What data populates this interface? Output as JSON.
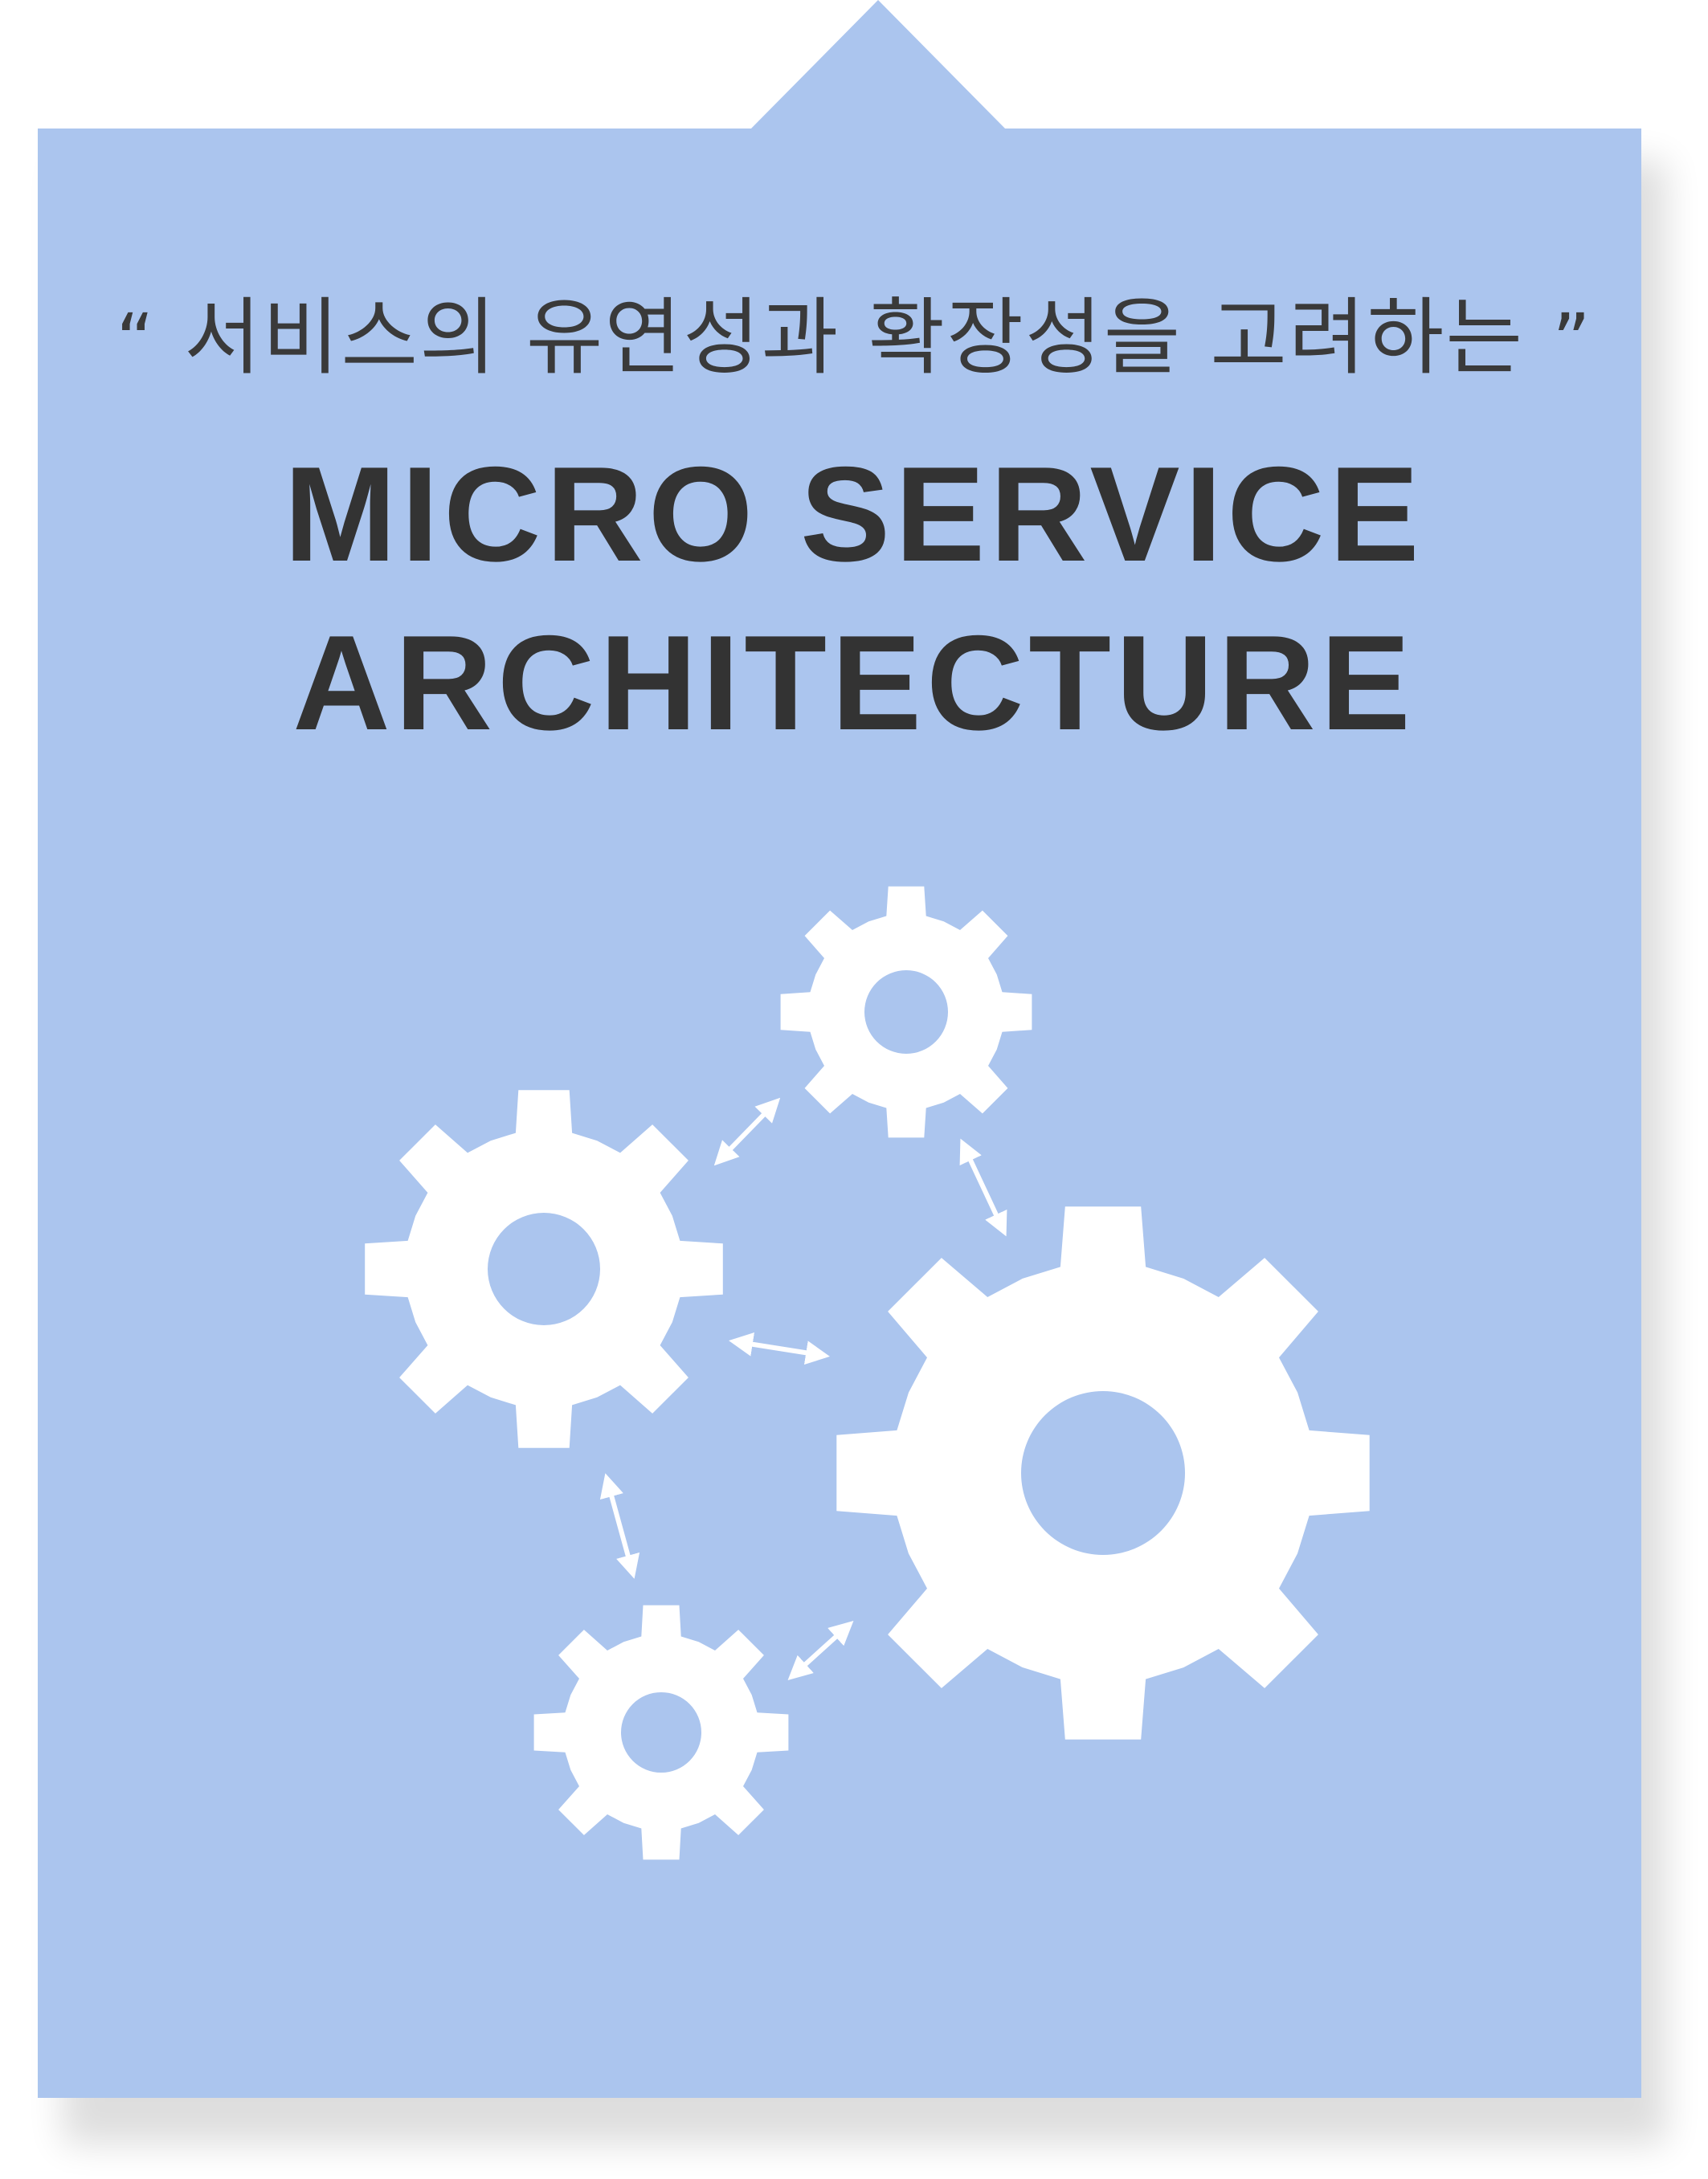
{
  "subtitle": {
    "open_quote": "“",
    "text": "서비스의 유연성과 확장성을 고려하는",
    "close_quote": "”"
  },
  "title": {
    "line1": "MICRO SERVICE",
    "line2": "ARCHITECTURE"
  },
  "colors": {
    "background": "#abc5ee",
    "text": "#333333",
    "gear": "#ffffff"
  },
  "icons": [
    "gear-icon",
    "gear-icon",
    "gear-icon",
    "gear-icon",
    "double-arrow-icon"
  ]
}
